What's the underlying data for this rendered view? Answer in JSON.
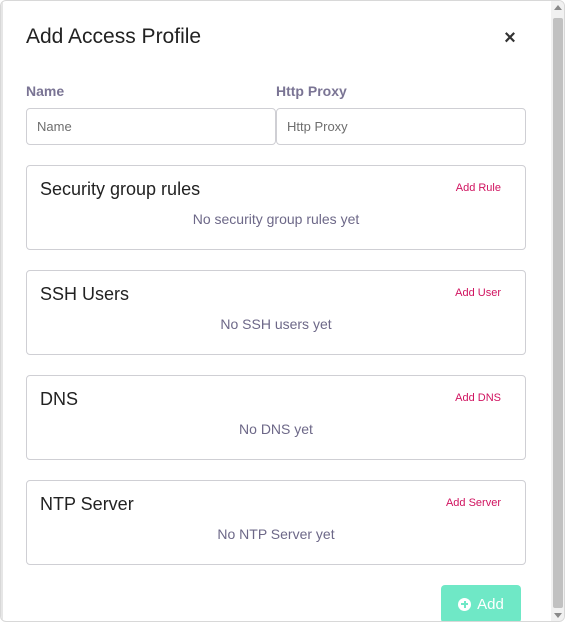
{
  "dialog": {
    "title": "Add Access Profile",
    "close_label": "×"
  },
  "form": {
    "name_label": "Name",
    "name_placeholder": "Name",
    "name_value": "",
    "proxy_label": "Http Proxy",
    "proxy_placeholder": "Http Proxy",
    "proxy_value": ""
  },
  "sections": {
    "security": {
      "title": "Security group rules",
      "action": "Add Rule",
      "empty": "No security group rules yet"
    },
    "ssh": {
      "title": "SSH Users",
      "action": "Add User",
      "empty": "No SSH users yet"
    },
    "dns": {
      "title": "DNS",
      "action": "Add DNS",
      "empty": "No DNS yet"
    },
    "ntp": {
      "title": "NTP Server",
      "action": "Add Server",
      "empty": "No NTP Server yet"
    }
  },
  "footer": {
    "add_label": "Add",
    "add_icon": "plus-circle-icon"
  },
  "colors": {
    "accent_link": "#d0125f",
    "add_button": "#6fe8c6",
    "label": "#7a7494"
  }
}
